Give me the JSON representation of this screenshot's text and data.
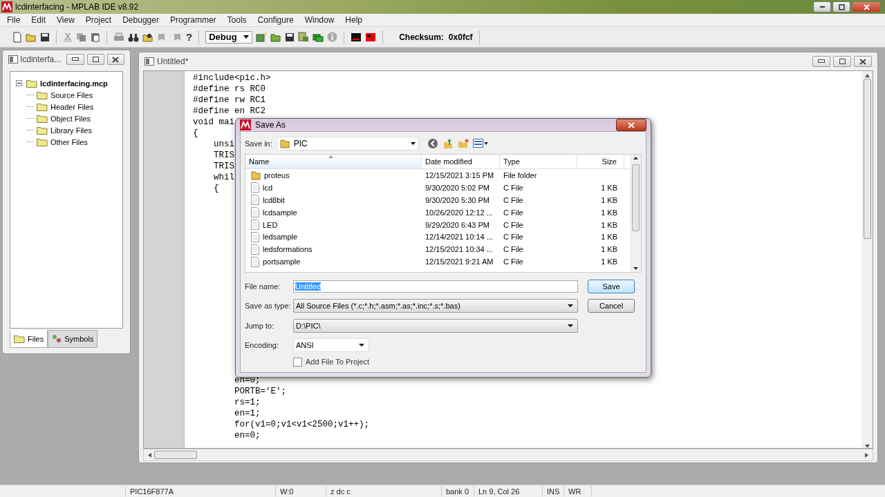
{
  "window": {
    "title": "lcdinterfacing - MPLAB IDE v8.92"
  },
  "menu": [
    "File",
    "Edit",
    "View",
    "Project",
    "Debugger",
    "Programmer",
    "Tools",
    "Configure",
    "Window",
    "Help"
  ],
  "toolbar": {
    "help_glyph": "?",
    "build_config": "Debug",
    "checksum_label": "Checksum:",
    "checksum_value": "0x0fcf"
  },
  "project_window": {
    "title": "lcdinterfa...",
    "tree": [
      {
        "label": "lcdinterfacing.mcp",
        "kind": "project",
        "expanded": true,
        "children": [
          {
            "label": "Source Files",
            "kind": "folder"
          },
          {
            "label": "Header Files",
            "kind": "folder"
          },
          {
            "label": "Object Files",
            "kind": "folder"
          },
          {
            "label": "Library Files",
            "kind": "folder"
          },
          {
            "label": "Other Files",
            "kind": "folder"
          }
        ]
      }
    ],
    "tabs": [
      {
        "label": "Files",
        "selected": true
      },
      {
        "label": "Symbols",
        "selected": false
      }
    ]
  },
  "editor": {
    "title": "Untitled*",
    "code_top": [
      "#include<pic.h>",
      "#define rs RC0",
      "#define rw RC1",
      "#define en RC2",
      "void mai",
      "{",
      "    unsi",
      "    TRIS",
      "    TRIS",
      "    whil",
      "    {"
    ],
    "code_bottom": [
      "        en=0;",
      "        PORTB='E';",
      "        rs=1;",
      "        en=1;",
      "        for(v1=0;v1<v1<2500;v1++);",
      "        en=0;"
    ]
  },
  "dialog": {
    "title": "Save As",
    "save_in_label": "Save in:",
    "save_in": "PIC",
    "columns": [
      {
        "label": "Name",
        "sorted": true
      },
      {
        "label": "Date modified",
        "sorted": false
      },
      {
        "label": "Type",
        "sorted": false
      },
      {
        "label": "Size",
        "sorted": false
      }
    ],
    "files": [
      {
        "name": "proteus",
        "date": "12/15/2021 3:15 PM",
        "type": "File folder",
        "kind": "folder"
      },
      {
        "name": "lcd",
        "date": "9/30/2020 5:02 PM",
        "type": "C File",
        "size": "1 KB",
        "kind": "file"
      },
      {
        "name": "lcd8bit",
        "date": "9/30/2020 5:30 PM",
        "type": "C File",
        "size": "1 KB",
        "kind": "file"
      },
      {
        "name": "lcdsample",
        "date": "10/26/2020 12:12 ...",
        "type": "C File",
        "size": "1 KB",
        "kind": "file"
      },
      {
        "name": "LED",
        "date": "9/29/2020 6:43 PM",
        "type": "C File",
        "size": "1 KB",
        "kind": "file"
      },
      {
        "name": "ledsample",
        "date": "12/14/2021 10:14 ...",
        "type": "C File",
        "size": "1 KB",
        "kind": "file"
      },
      {
        "name": "ledsformations",
        "date": "12/15/2021 10:34 ...",
        "type": "C File",
        "size": "1 KB",
        "kind": "file"
      },
      {
        "name": "portsample",
        "date": "12/15/2021 9:21 AM",
        "type": "C File",
        "size": "1 KB",
        "kind": "file"
      }
    ],
    "file_name_label": "File name:",
    "file_name": "Untitled",
    "type_label": "Save as type:",
    "save_type": "All Source Files (*.c;*.h;*.asm;*.as;*.inc;*.s;*.bas)",
    "jump_label": "Jump to:",
    "jump_to": "D:\\PIC\\",
    "encoding_label": "Encoding:",
    "encoding": "ANSI",
    "add_to_project": {
      "label": "Add File To Project",
      "checked": false
    },
    "buttons": [
      "Save",
      "Cancel"
    ]
  },
  "status_bar": [
    "PIC16F877A",
    "W:0",
    "z dc c",
    "bank 0",
    "Ln 9, Col 26",
    "INS",
    "WR"
  ]
}
